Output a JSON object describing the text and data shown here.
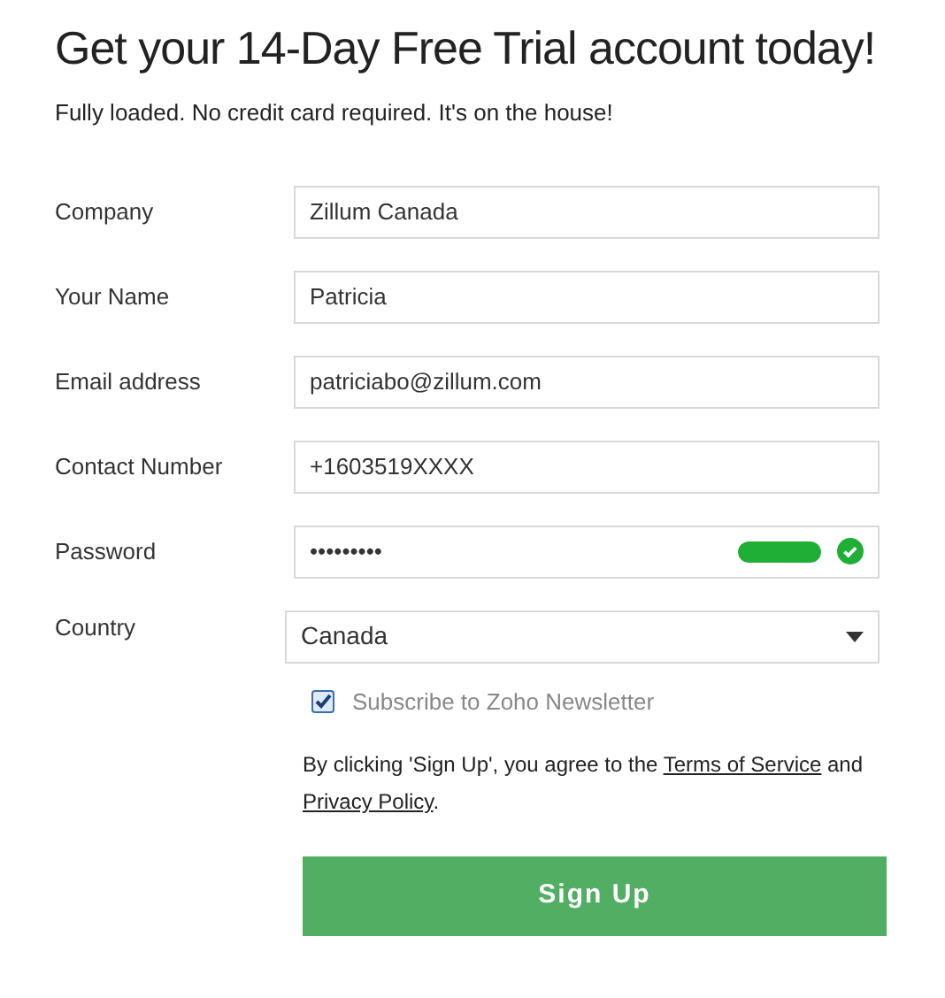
{
  "title": "Get your 14-Day Free Trial account today!",
  "subtitle": "Fully loaded. No credit card required. It's on the house!",
  "fields": [
    {
      "kind": "text",
      "label": "Company",
      "value": "Zillum Canada"
    },
    {
      "kind": "text",
      "label": "Your Name",
      "value": "Patricia"
    },
    {
      "kind": "text",
      "label": "Email address",
      "value": "patriciabo@zillum.com"
    },
    {
      "kind": "text",
      "label": "Contact Number",
      "value": "+1603519XXXX"
    },
    {
      "kind": "password",
      "label": "Password",
      "value": "•••••••••",
      "strength": {
        "level": 1
      },
      "valid": true
    },
    {
      "kind": "select",
      "label": "Country",
      "value": "Canada"
    }
  ],
  "newsletter": {
    "label": "Subscribe to Zoho Newsletter",
    "checked": true
  },
  "terms": {
    "before": "By clicking 'Sign Up', you agree to the ",
    "link_1": "Terms of Service",
    "middle": " and ",
    "link_2": "Privacy Policy",
    "after": "."
  },
  "submit": "Sign Up"
}
